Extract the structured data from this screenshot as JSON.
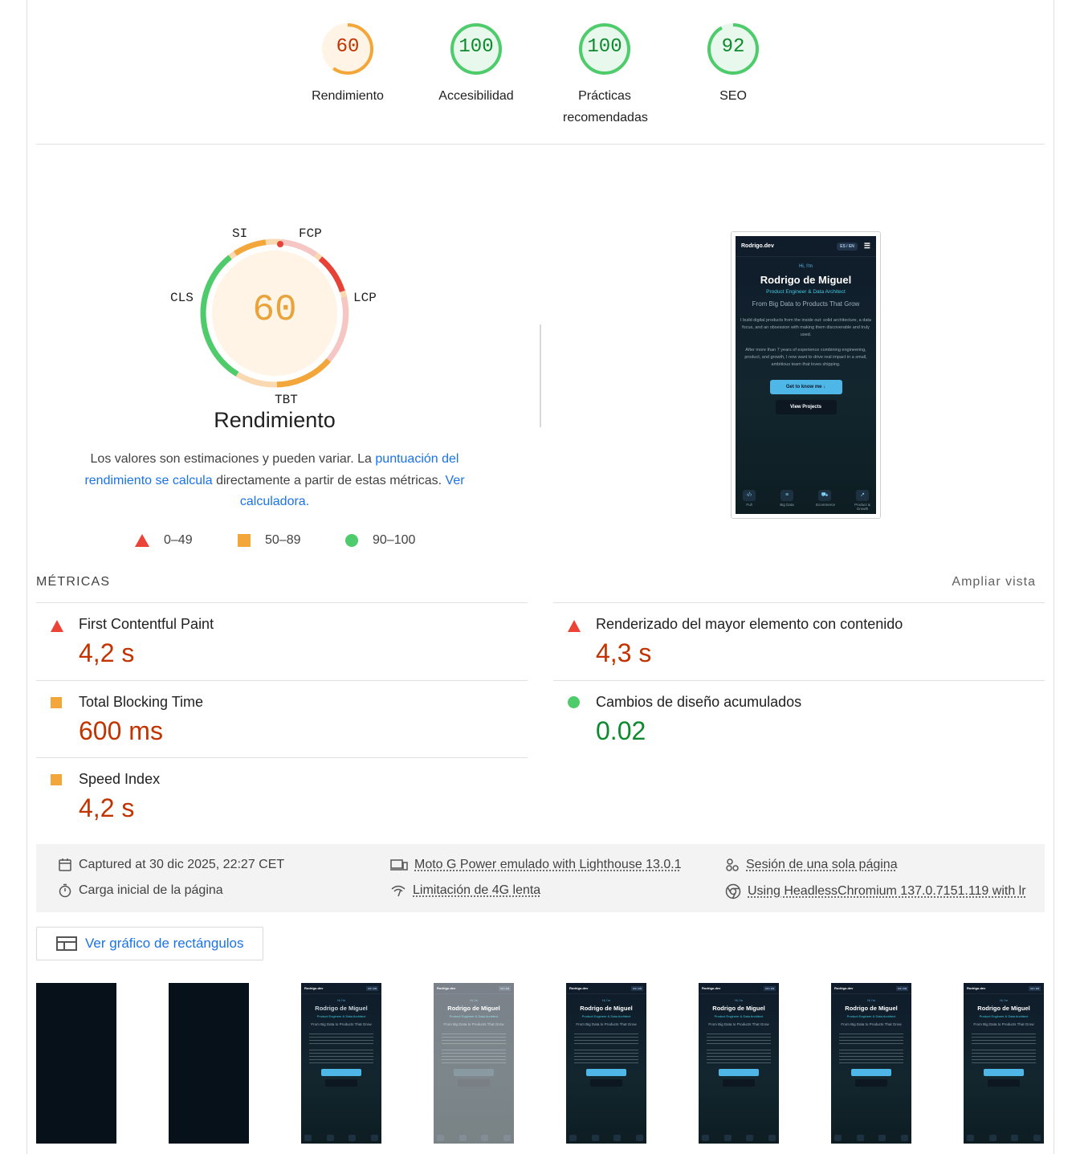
{
  "categories": [
    {
      "score": "60",
      "label": "Rendimiento",
      "value": 0.6,
      "color": "#f3a73b",
      "bg": "#fff4e5",
      "text_color": "#c33300"
    },
    {
      "score": "100",
      "label": "Accesibilidad",
      "value": 1.0,
      "color": "#4ecb6a",
      "bg": "#e8f8ec",
      "text_color": "#0d8a2d"
    },
    {
      "score": "100",
      "label": "Prácticas recomendadas",
      "value": 1.0,
      "color": "#4ecb6a",
      "bg": "#e8f8ec",
      "text_color": "#0d8a2d"
    },
    {
      "score": "92",
      "label": "SEO",
      "value": 0.92,
      "color": "#4ecb6a",
      "bg": "#e8f8ec",
      "text_color": "#0d8a2d"
    }
  ],
  "performance": {
    "score": "60",
    "title": "Rendimiento",
    "metric_labels": {
      "si": "SI",
      "fcp": "FCP",
      "lcp": "LCP",
      "tbt": "TBT",
      "cls": "CLS"
    },
    "description_1": "Los valores son estimaciones y pueden variar. La ",
    "description_link_1": "puntuación del rendimiento se calcula",
    "description_2": " directamente a partir de estas métricas. ",
    "description_link_2": "Ver calculadora.",
    "legend": [
      "0–49",
      "50–89",
      "90–100"
    ]
  },
  "screenshot": {
    "brand": "Rodrigo.dev",
    "lang": "ES / EN",
    "hi": "Hi, I'm",
    "name": "Rodrigo de Miguel",
    "role": "Product Engineer & Data Architect",
    "tagline": "From Big Data to Products That Grow",
    "para1": "I build digital products from the inside out: solid architecture, a data focus, and an obsession with making them discoverable and truly used.",
    "para2": "After more than 7 years of experience combining engineering, product, and growth, I now want to drive real impact in a small, ambitious team that loves shipping.",
    "button_primary": "Get to know me ↓",
    "button_secondary": "View Projects",
    "icons": [
      "Full",
      "Big Data",
      "Ecommerce",
      "Product & Growth"
    ]
  },
  "metrics": {
    "heading": "MÉTRICAS",
    "expand": "Ampliar vista",
    "items": [
      {
        "name": "First Contentful Paint",
        "value": "4,2 s",
        "status": "red"
      },
      {
        "name": "Renderizado del mayor elemento con contenido",
        "value": "4,3 s",
        "status": "red"
      },
      {
        "name": "Total Blocking Time",
        "value": "600 ms",
        "status": "orange"
      },
      {
        "name": "Cambios de diseño acumulados",
        "value": "0.02",
        "status": "green"
      },
      {
        "name": "Speed Index",
        "value": "4,2 s",
        "status": "orange"
      }
    ]
  },
  "info": {
    "captured": "Captured at 30 dic 2025, 22:27 CET",
    "load": "Carga inicial de la página",
    "device": "Moto G Power emulado with Lighthouse 13.0.1",
    "throttle": "Limitación de 4G lenta",
    "session": "Sesión de una sola página",
    "browser": "Using HeadlessChromium 137.0.7151.119 with lr"
  },
  "treemap_label": "Ver gráfico de rectángulos",
  "filmstrip": [
    "blank",
    "blank",
    "page",
    "faded",
    "page",
    "page",
    "page",
    "page"
  ]
}
